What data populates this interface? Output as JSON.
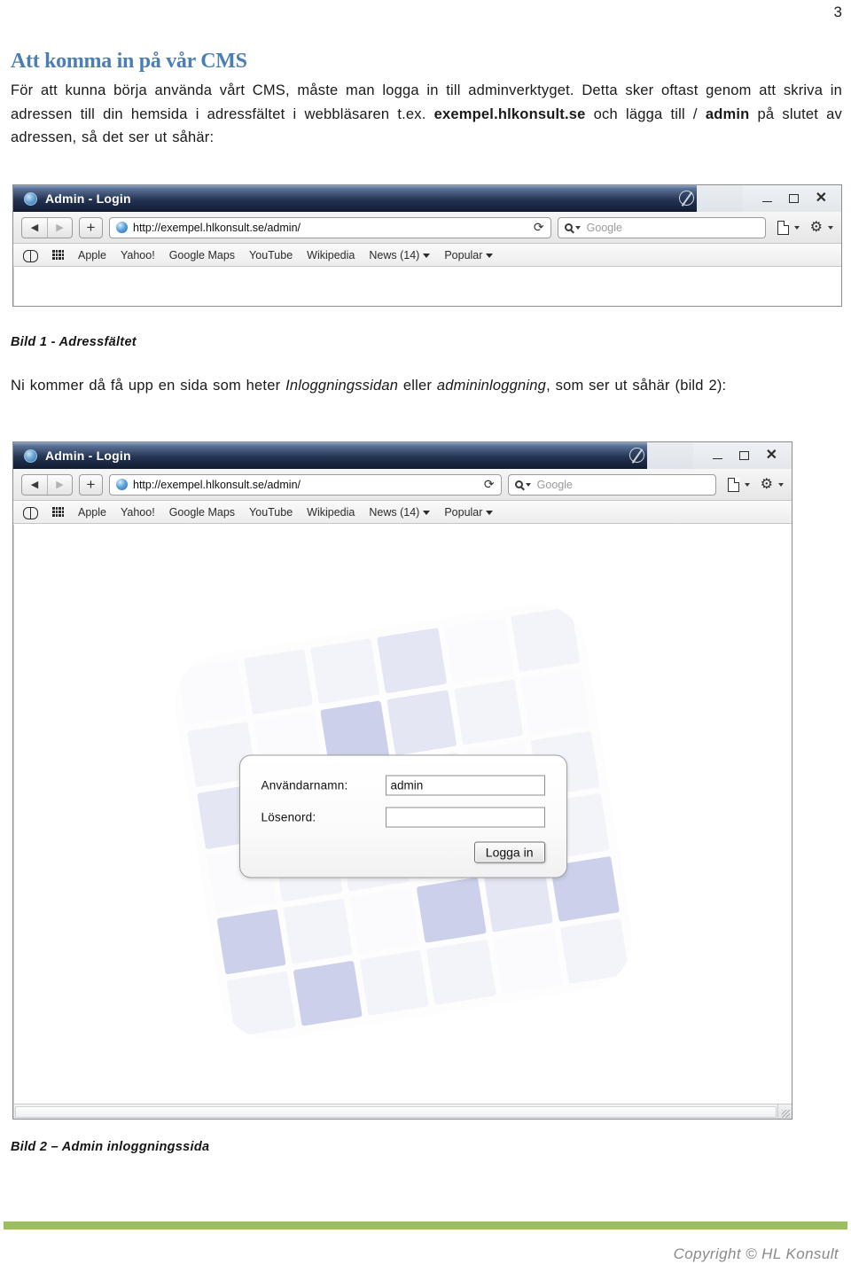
{
  "page": {
    "number": "3"
  },
  "heading": {
    "title": "Att komma in på vår CMS"
  },
  "intro": {
    "part1": "För att kunna börja använda vårt CMS, måste man logga in till adminverktyget. Detta sker oftast genom att skriva in adressen till din hemsida i adressfältet i webbläsaren t.ex. ",
    "bold1": "exempel.hlkonsult.se",
    "part2": " och lägga till / ",
    "bold2": "admin",
    "part3": " på slutet av adressen, så det ser ut såhär:"
  },
  "caption1": {
    "text": "Bild 1 - Adressfältet"
  },
  "para2": {
    "part1": "Ni kommer då få upp en sida som heter ",
    "italic1": "Inloggningssidan",
    "part2": " eller ",
    "italic2": "admininloggning",
    "part3": ", som ser ut såhär (bild 2):"
  },
  "caption2": {
    "text": "Bild 2 – Admin inloggningssida"
  },
  "browser": {
    "title": "Admin - Login",
    "window_controls": {
      "minimize": "minimize",
      "maximize": "maximize",
      "close": "✕"
    },
    "nav": {
      "back": "◀",
      "forward": "▶",
      "new_tab": "+"
    },
    "url": "http://exempel.hlkonsult.se/admin/",
    "reload": "⟳",
    "search_placeholder": "Google",
    "bookmarks": [
      {
        "label": "Apple",
        "has_arrow": false
      },
      {
        "label": "Yahoo!",
        "has_arrow": false
      },
      {
        "label": "Google Maps",
        "has_arrow": false
      },
      {
        "label": "YouTube",
        "has_arrow": false
      },
      {
        "label": "Wikipedia",
        "has_arrow": false
      },
      {
        "label": "News (14)",
        "has_arrow": true
      },
      {
        "label": "Popular",
        "has_arrow": true
      }
    ]
  },
  "login_form": {
    "username_label": "Användarnamn:",
    "username_value": "admin",
    "password_label": "Lösenord:",
    "password_value": "",
    "submit_label": "Logga in"
  },
  "footer": {
    "copyright": "Copyright © HL Konsult"
  },
  "colors": {
    "heading_blue": "#4a7eb5",
    "footer_green": "#9cbe5f",
    "titlebar_dark": "#1b2740",
    "tile_lavender": "#ccd0ea"
  }
}
